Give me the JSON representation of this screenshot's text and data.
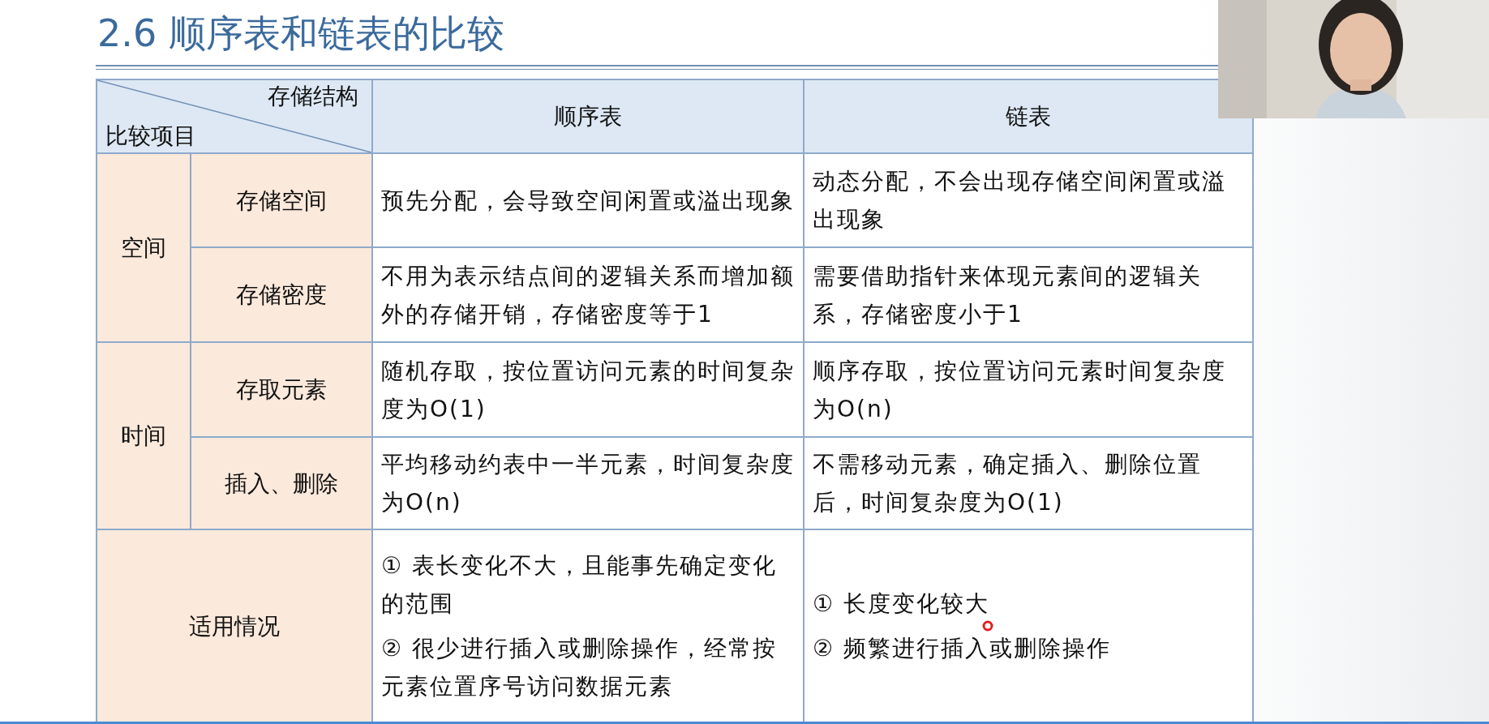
{
  "title": "2.6 顺序表和链表的比较",
  "table": {
    "corner": {
      "top": "存储结构",
      "bottom": "比较项目"
    },
    "columns": [
      "顺序表",
      "链表"
    ],
    "groups": [
      {
        "label": "空间",
        "rows": [
          {
            "label": "存储空间",
            "cells": [
              "预先分配，会导致空间闲置或溢出现象",
              "动态分配，不会出现存储空间闲置或溢出现象"
            ]
          },
          {
            "label": "存储密度",
            "cells": [
              "不用为表示结点间的逻辑关系而增加额外的存储开销，存储密度等于1",
              "需要借助指针来体现元素间的逻辑关系，存储密度小于1"
            ]
          }
        ]
      },
      {
        "label": "时间",
        "rows": [
          {
            "label": "存取元素",
            "cells": [
              "随机存取，按位置访问元素的时间复杂度为O(1)",
              "顺序存取，按位置访问元素时间复杂度为O(n)"
            ]
          },
          {
            "label": "插入、删除",
            "cells": [
              "平均移动约表中一半元素，时间复杂度为O(n)",
              "不需移动元素，确定插入、删除位置后，时间复杂度为O(1)"
            ]
          }
        ]
      }
    ],
    "footer": {
      "label": "适用情况",
      "cells": [
        [
          "① 表长变化不大，且能事先确定变化的范围",
          "② 很少进行插入或删除操作，经常按元素位置序号访问数据元素"
        ],
        [
          "① 长度变化较大",
          "② 频繁进行插入或删除操作"
        ]
      ]
    }
  }
}
